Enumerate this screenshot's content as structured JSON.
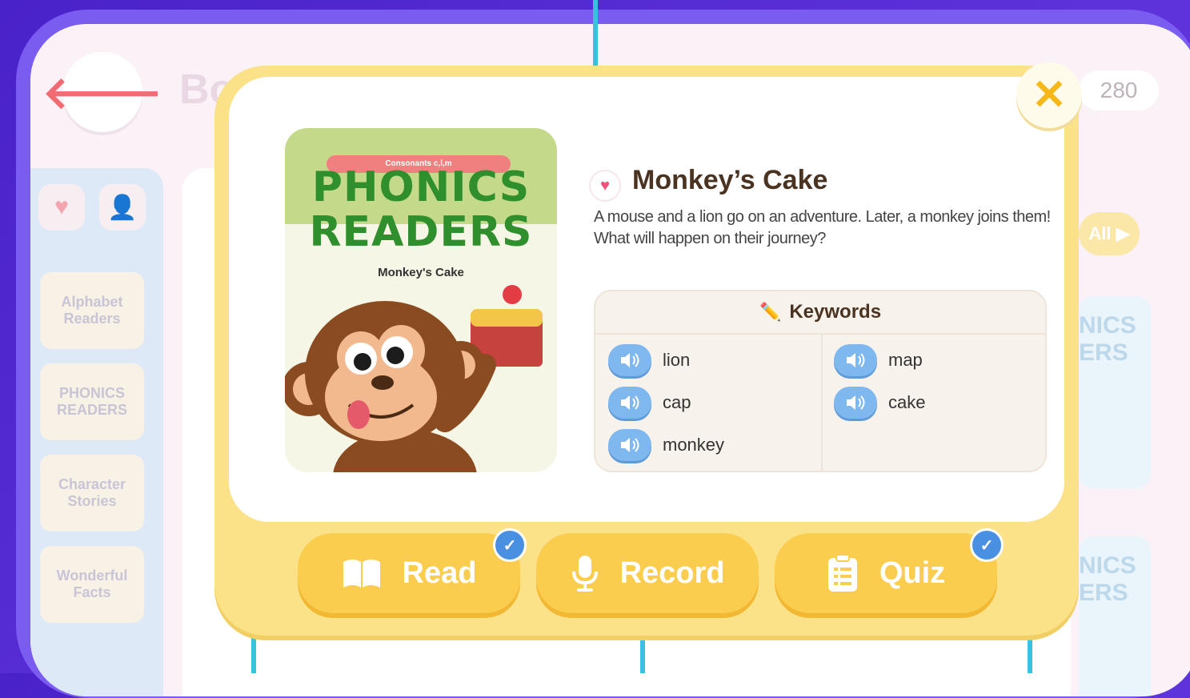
{
  "background_app": {
    "title_partial": "Bo",
    "points": "280",
    "sidebar_cards": [
      "Alphabet Readers",
      "PHONICS READERS",
      "Character Stories",
      "Wonderful Facts"
    ],
    "all_label": "All ▶",
    "peek_cards": [
      "NICS ERS",
      "NICS ERS"
    ]
  },
  "modal": {
    "close_glyph": "✕",
    "cover": {
      "badge": "Consonants c,l,m",
      "title_line1": "PHONICS",
      "title_line2": "READERS",
      "subtitle": "Monkey's Cake"
    },
    "title": "Monkey’s Cake",
    "description": "A mouse and a lion go on an adventure. Later, a monkey joins them! What will happen on their journey?",
    "keywords_heading": "Keywords",
    "keywords": [
      "lion",
      "cap",
      "monkey",
      "map",
      "cake"
    ],
    "actions": {
      "read": "Read",
      "record": "Record",
      "quiz": "Quiz"
    }
  },
  "icons": [
    "back-arrow-icon",
    "close-icon",
    "heart-icon",
    "pencil-icon",
    "speaker-icon",
    "book-icon",
    "microphone-icon",
    "clipboard-icon",
    "checkmark-icon"
  ],
  "colors": {
    "frame": "#5a2fd8",
    "modal": "#fbe289",
    "button": "#fbcd4e",
    "speaker": "#7fb8ef",
    "callout": "#39c2dd",
    "title_text": "#4a3320"
  }
}
